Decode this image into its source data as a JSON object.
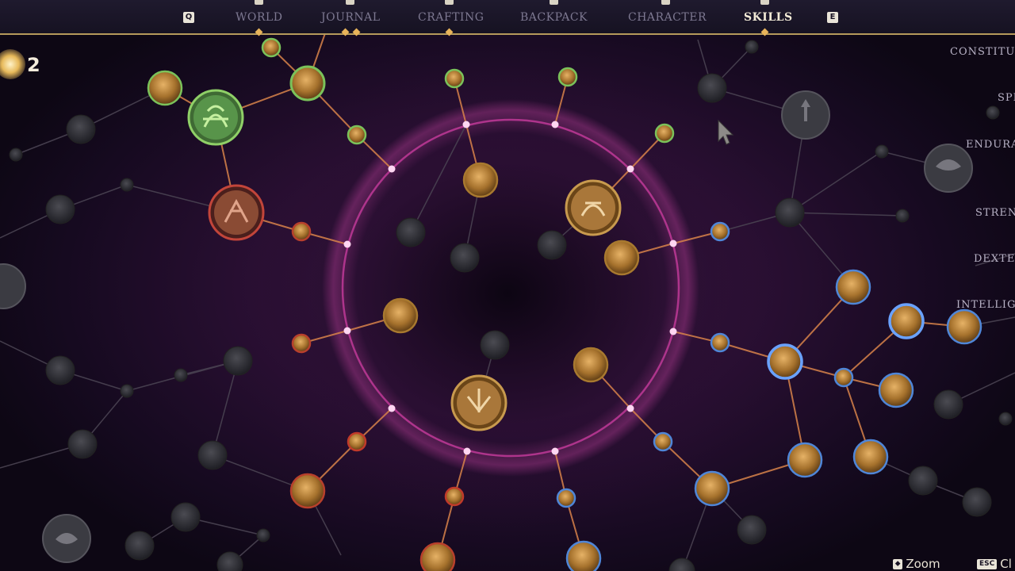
{
  "nav": {
    "left_key": "Q",
    "right_key": "E",
    "tabs": [
      {
        "label": "WORLD",
        "active": false
      },
      {
        "label": "JOURNAL",
        "active": false
      },
      {
        "label": "CRAFTING",
        "active": false
      },
      {
        "label": "BACKPACK",
        "active": false
      },
      {
        "label": "CHARACTER",
        "active": false
      },
      {
        "label": "SKILLS",
        "active": true
      }
    ]
  },
  "skill_points": {
    "value": "2",
    "icon": "sun-icon"
  },
  "attributes": [
    "CONSTITUT",
    "SPE",
    "ENDURAN",
    "STRENG",
    "DEXTER",
    "INTELLIGEN"
  ],
  "hints": {
    "zoom": {
      "key": "⬥",
      "label": "Zoom"
    },
    "close": {
      "key": "ESC",
      "label": "Cl"
    }
  },
  "colors": {
    "ring": "#d04aa8",
    "bronze": "#a8792f",
    "green": "#7bc25a",
    "red": "#b8402c",
    "blue": "#4f86d8",
    "locked": "#3a3a3f"
  }
}
